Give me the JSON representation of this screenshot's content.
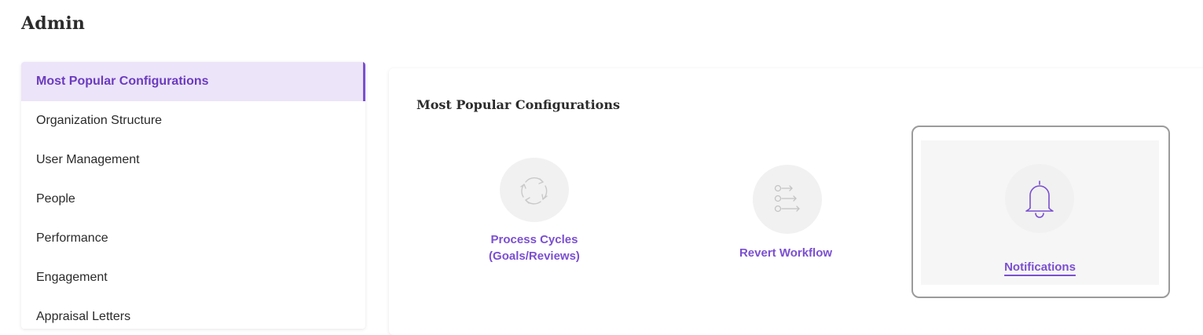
{
  "page": {
    "title": "Admin"
  },
  "sidebar": {
    "items": [
      {
        "label": "Most Popular Configurations",
        "active": true
      },
      {
        "label": "Organization Structure",
        "active": false
      },
      {
        "label": "User Management",
        "active": false
      },
      {
        "label": "People",
        "active": false
      },
      {
        "label": "Performance",
        "active": false
      },
      {
        "label": "Engagement",
        "active": false
      },
      {
        "label": "Appraisal Letters",
        "active": false
      }
    ]
  },
  "main": {
    "section_title": "Most Popular Configurations",
    "cards": [
      {
        "label": "Process Cycles\n(Goals/Reviews)",
        "icon": "cycle-arrows-icon"
      },
      {
        "label": "Revert Workflow",
        "icon": "revert-workflow-icon"
      },
      {
        "label": "Notifications",
        "icon": "bell-icon",
        "selected": true
      }
    ]
  },
  "colors": {
    "accent": "#7b4fd0",
    "active_bg": "#ece4f9",
    "selection_border": "#9b9b9b"
  }
}
